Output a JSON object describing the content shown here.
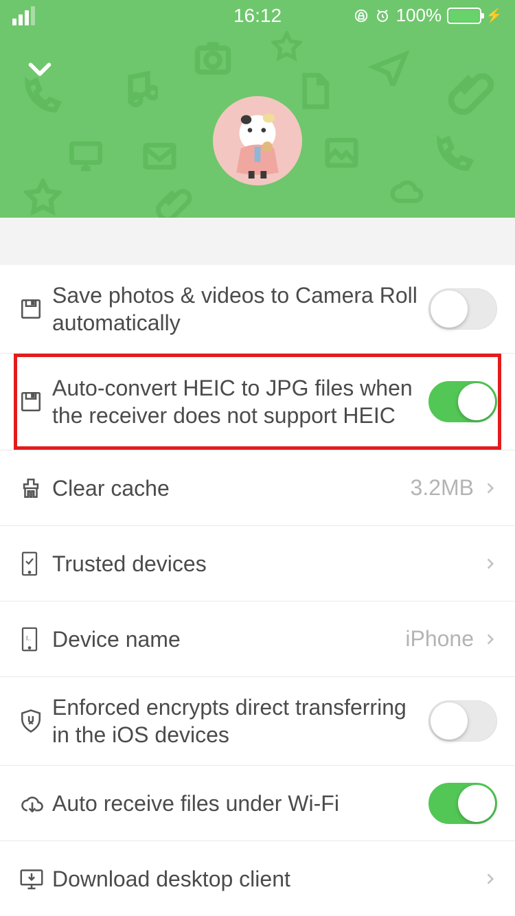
{
  "statusbar": {
    "time": "16:12",
    "battery_pct": "100%"
  },
  "settings": {
    "save_camera_roll": {
      "label": "Save photos & videos to Camera Roll automatically",
      "on": false
    },
    "auto_convert_heic": {
      "label": "Auto-convert HEIC to JPG files when the receiver does not support HEIC",
      "on": true,
      "highlighted": true
    },
    "clear_cache": {
      "label": "Clear cache",
      "value": "3.2MB"
    },
    "trusted_devices": {
      "label": "Trusted devices"
    },
    "device_name": {
      "label": "Device name",
      "value": "iPhone"
    },
    "enforced_encrypt": {
      "label": "Enforced encrypts direct transferring in the iOS devices",
      "on": false
    },
    "auto_receive_wifi": {
      "label": "Auto receive files under Wi-Fi",
      "on": true
    },
    "download_desktop": {
      "label": "Download desktop client"
    }
  }
}
